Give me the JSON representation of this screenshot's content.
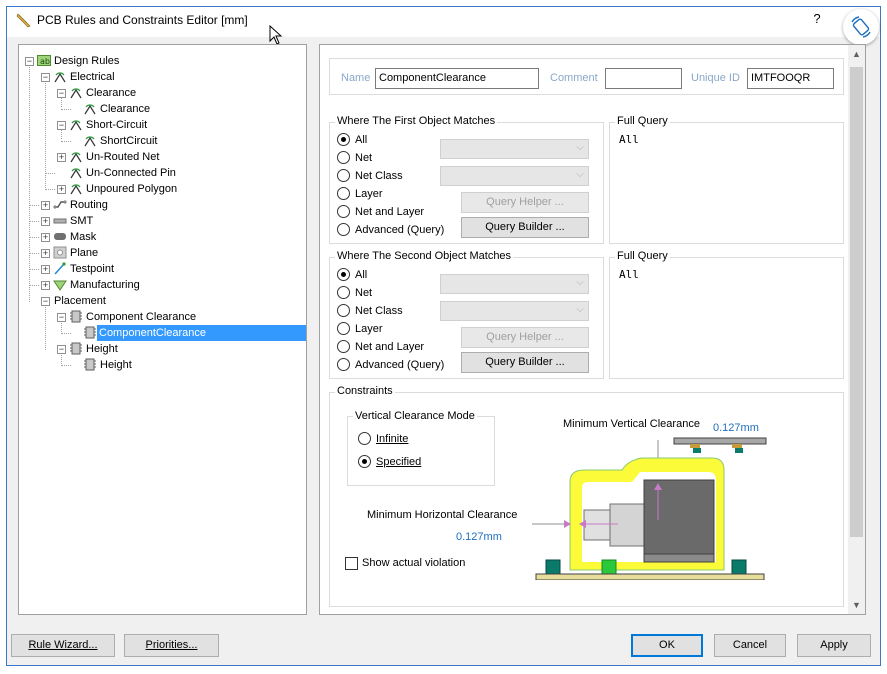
{
  "window": {
    "title": "PCB Rules and Constraints Editor [mm]",
    "help": "?"
  },
  "tree": {
    "items": [
      {
        "label": "Design Rules"
      },
      {
        "label": "Electrical"
      },
      {
        "label": "Clearance"
      },
      {
        "label": "Clearance"
      },
      {
        "label": "Short-Circuit"
      },
      {
        "label": "ShortCircuit"
      },
      {
        "label": "Un-Routed Net"
      },
      {
        "label": "Un-Connected Pin"
      },
      {
        "label": "Unpoured Polygon"
      },
      {
        "label": "Routing"
      },
      {
        "label": "SMT"
      },
      {
        "label": "Mask"
      },
      {
        "label": "Plane"
      },
      {
        "label": "Testpoint"
      },
      {
        "label": "Manufacturing"
      },
      {
        "label": "Placement"
      },
      {
        "label": "Component Clearance"
      },
      {
        "label": "ComponentClearance"
      },
      {
        "label": "Height"
      },
      {
        "label": "Height"
      }
    ]
  },
  "rule": {
    "name_label": "Name",
    "name_value": "ComponentClearance",
    "comment_label": "Comment",
    "comment_value": "",
    "uid_label": "Unique ID",
    "uid_value": "IMTFOOQR"
  },
  "first": {
    "title": "Where The First Object Matches",
    "options": [
      "All",
      "Net",
      "Net Class",
      "Layer",
      "Net and Layer",
      "Advanced (Query)"
    ],
    "selected": "All",
    "query_helper": "Query Helper ...",
    "query_builder": "Query Builder ...",
    "full_query_title": "Full Query",
    "full_query": "All"
  },
  "second": {
    "title": "Where The Second Object Matches",
    "options": [
      "All",
      "Net",
      "Net Class",
      "Layer",
      "Net and Layer",
      "Advanced (Query)"
    ],
    "selected": "All",
    "query_helper": "Query Helper ...",
    "query_builder": "Query Builder ...",
    "full_query_title": "Full Query",
    "full_query": "All"
  },
  "constraints": {
    "title": "Constraints",
    "mode_title": "Vertical Clearance Mode",
    "mode_infinite": "Infinite",
    "mode_specified": "Specified",
    "selected_mode": "Specified",
    "min_vertical_label": "Minimum Vertical Clearance",
    "min_vertical_value": "0.127mm",
    "min_horizontal_label": "Minimum Horizontal Clearance",
    "min_horizontal_value": "0.127mm",
    "show_violation": "Show actual violation",
    "show_violation_checked": false,
    "value_color": "#1e6fc0"
  },
  "footer": {
    "rule_wizard": "Rule Wizard...",
    "priorities": "Priorities...",
    "ok": "OK",
    "cancel": "Cancel",
    "apply": "Apply"
  },
  "icons": {
    "title": "ruler-pencil-icon",
    "rotate": "screen-rotate-icon",
    "cursor": "mouse-pointer-icon"
  }
}
